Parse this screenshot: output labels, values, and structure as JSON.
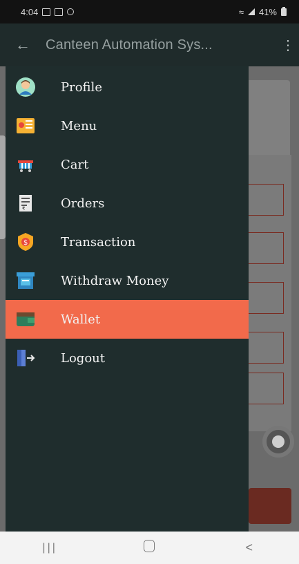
{
  "status_bar": {
    "time": "4:04",
    "battery": "41%"
  },
  "app_bar": {
    "title": "Canteen Automation Sys...",
    "back_icon": "arrow-left-icon",
    "overflow_icon": "more-vertical-icon"
  },
  "drawer": {
    "items": [
      {
        "label": "Profile",
        "icon": "profile-avatar-icon"
      },
      {
        "label": "Menu",
        "icon": "menu-card-icon"
      },
      {
        "label": "Cart",
        "icon": "cart-icon"
      },
      {
        "label": "Orders",
        "icon": "orders-receipt-icon"
      },
      {
        "label": "Transaction",
        "icon": "transaction-badge-icon"
      },
      {
        "label": "Withdraw Money",
        "icon": "withdraw-atm-icon"
      },
      {
        "label": "Wallet",
        "icon": "wallet-icon"
      },
      {
        "label": "Logout",
        "icon": "logout-door-icon"
      }
    ],
    "active_item": "Wallet",
    "active_color": "#f26a4b",
    "background_color": "#1f2d2d"
  },
  "nav_bar": {
    "recents_icon": "recents-icon",
    "home_icon": "home-icon",
    "back_icon": "back-chevron-icon"
  }
}
